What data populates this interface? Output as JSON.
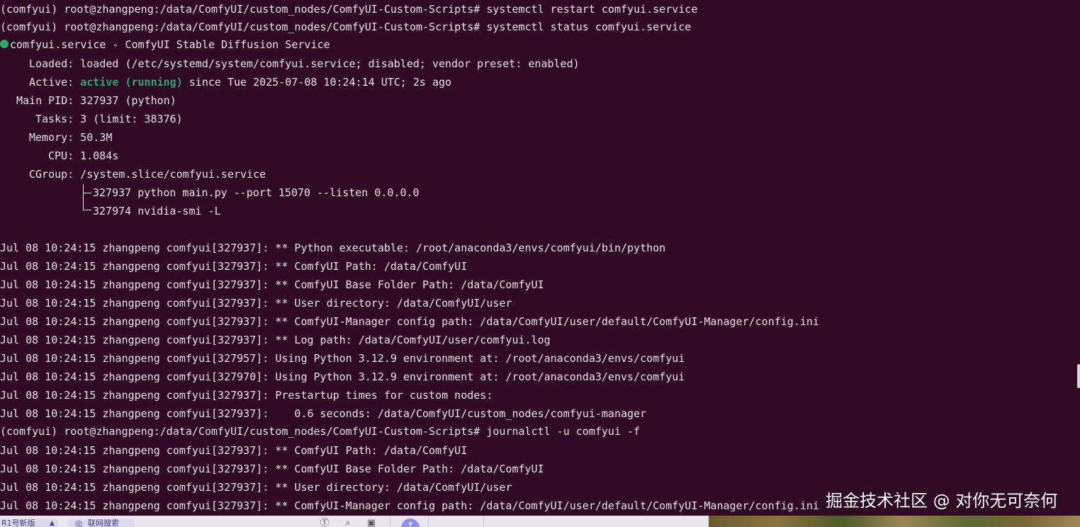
{
  "colors": {
    "background": "#300a24",
    "foreground": "#e8e3e6",
    "status_green": "#2ea86b"
  },
  "terminal": {
    "cmd1": "(comfyui) root@zhangpeng:/data/ComfyUI/custom_nodes/ComfyUI-Custom-Scripts# systemctl restart comfyui.service",
    "cmd2": "(comfyui) root@zhangpeng:/data/ComfyUI/custom_nodes/ComfyUI-Custom-Scripts# systemctl status comfyui.service",
    "status": {
      "dot_icon": "status-dot-icon",
      "title": "comfyui.service - ComfyUI Stable Diffusion Service",
      "loaded": "Loaded: loaded (/etc/systemd/system/comfyui.service; disabled; vendor preset: enabled)",
      "active_label": "Active: ",
      "active_state": "active (running)",
      "active_rest": " since Tue 2025-07-08 10:24:14 UTC; 2s ago",
      "main_pid": "Main PID: 327937 (python)",
      "tasks": "Tasks: 3 (limit: 38376)",
      "memory": "Memory: 50.3M",
      "cpu": "CPU: 1.084s",
      "cgroup": "CGroup: /system.slice/comfyui.service",
      "proc1": "327937 python main.py --port 15070 --listen 0.0.0.0",
      "proc2": "327974 nvidia-smi -L"
    },
    "log1": [
      "Jul 08 10:24:15 zhangpeng comfyui[327937]: ** Python executable: /root/anaconda3/envs/comfyui/bin/python",
      "Jul 08 10:24:15 zhangpeng comfyui[327937]: ** ComfyUI Path: /data/ComfyUI",
      "Jul 08 10:24:15 zhangpeng comfyui[327937]: ** ComfyUI Base Folder Path: /data/ComfyUI",
      "Jul 08 10:24:15 zhangpeng comfyui[327937]: ** User directory: /data/ComfyUI/user",
      "Jul 08 10:24:15 zhangpeng comfyui[327937]: ** ComfyUI-Manager config path: /data/ComfyUI/user/default/ComfyUI-Manager/config.ini",
      "Jul 08 10:24:15 zhangpeng comfyui[327937]: ** Log path: /data/ComfyUI/user/comfyui.log",
      "Jul 08 10:24:15 zhangpeng comfyui[327957]: Using Python 3.12.9 environment at: /root/anaconda3/envs/comfyui",
      "Jul 08 10:24:15 zhangpeng comfyui[327970]: Using Python 3.12.9 environment at: /root/anaconda3/envs/comfyui",
      "Jul 08 10:24:15 zhangpeng comfyui[327937]: Prestartup times for custom nodes:",
      "Jul 08 10:24:15 zhangpeng comfyui[327937]:    0.6 seconds: /data/ComfyUI/custom_nodes/comfyui-manager"
    ],
    "cmd3": "(comfyui) root@zhangpeng:/data/ComfyUI/custom_nodes/ComfyUI-Custom-Scripts# journalctl -u comfyui -f",
    "log2": [
      "Jul 08 10:24:15 zhangpeng comfyui[327937]: ** ComfyUI Path: /data/ComfyUI",
      "Jul 08 10:24:15 zhangpeng comfyui[327937]: ** ComfyUI Base Folder Path: /data/ComfyUI",
      "Jul 08 10:24:15 zhangpeng comfyui[327937]: ** User directory: /data/ComfyUI/user",
      "Jul 08 10:24:15 zhangpeng comfyui[327937]: ** ComfyUI-Manager config path: /data/ComfyUI/user/default/ComfyUI-Manager/config.ini"
    ]
  },
  "taskbar": {
    "item1": "R1号新版",
    "item1_icon": "chevron-up-icon",
    "item2": "联网搜索",
    "item2_icon": "globe-icon",
    "icon_a": "translate-icon",
    "icon_b": "paperclip-icon",
    "icon_c": "image-icon",
    "icon_d": "send-icon"
  },
  "watermark": "掘金技术社区 @ 对你无可奈何"
}
